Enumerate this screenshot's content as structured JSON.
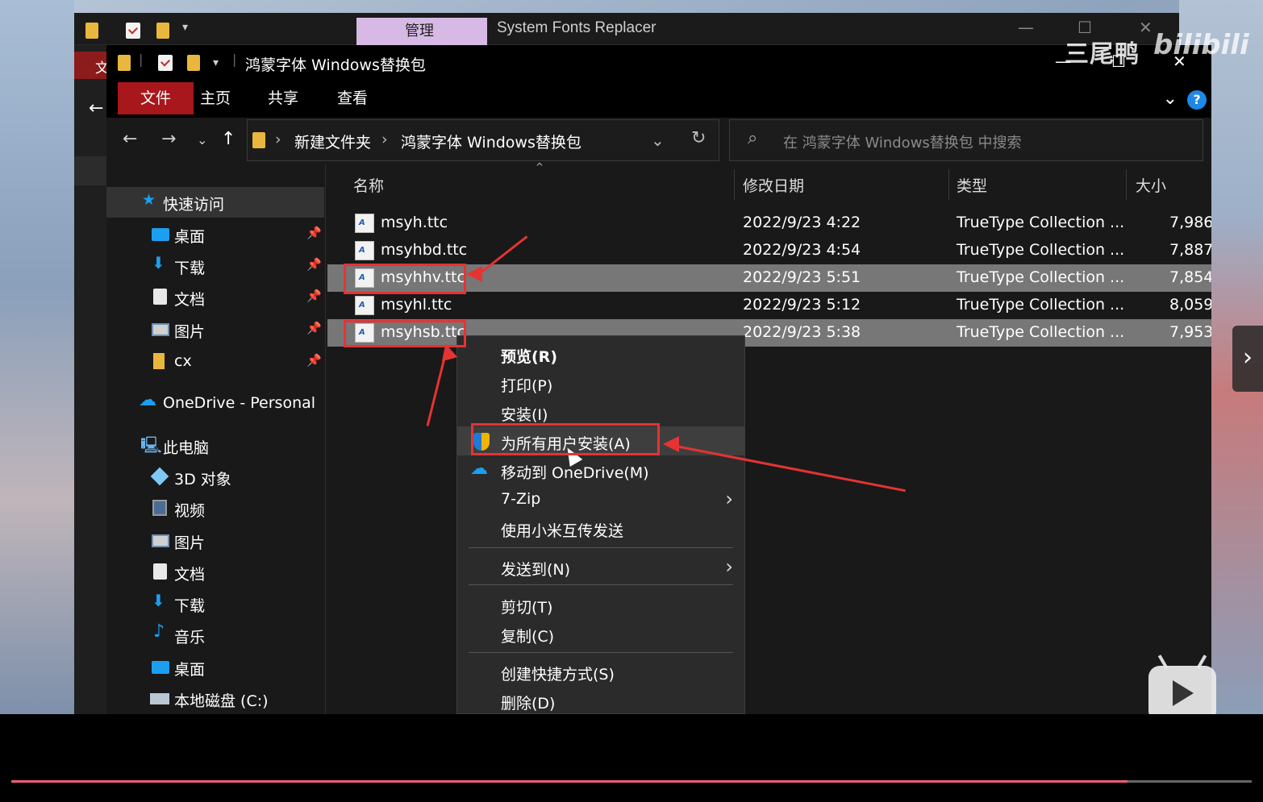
{
  "back_window": {
    "manage_tab": "管理",
    "title": "System Fonts Replacer",
    "file_tab_partial": "文"
  },
  "window": {
    "title": "鸿蒙字体 Windows替换包",
    "ribbon_tabs": [
      "文件",
      "主页",
      "共享",
      "查看"
    ],
    "help": "?"
  },
  "address": {
    "crumbs": [
      "新建文件夹",
      "鸿蒙字体 Windows替换包"
    ]
  },
  "search": {
    "placeholder": "在 鸿蒙字体 Windows替换包 中搜索"
  },
  "nav_pane": {
    "quick_access": "快速访问",
    "quick_items": [
      "桌面",
      "下载",
      "文档",
      "图片",
      "cx"
    ],
    "onedrive": "OneDrive - Personal",
    "this_pc": "此电脑",
    "pc_items": [
      "3D 对象",
      "视频",
      "图片",
      "文档",
      "下载",
      "音乐",
      "桌面",
      "本地磁盘 (C:)"
    ]
  },
  "columns": {
    "name": "名称",
    "date": "修改日期",
    "type": "类型",
    "size": "大小"
  },
  "files": [
    {
      "name": "msyh.ttc",
      "date": "2022/9/23 4:22",
      "type": "TrueType Collection ...",
      "size": "7,986",
      "selected": false
    },
    {
      "name": "msyhbd.ttc",
      "date": "2022/9/23 4:54",
      "type": "TrueType Collection ...",
      "size": "7,887",
      "selected": false
    },
    {
      "name": "msyhhv.ttc",
      "date": "2022/9/23 5:51",
      "type": "TrueType Collection ...",
      "size": "7,854",
      "selected": true
    },
    {
      "name": "msyhl.ttc",
      "date": "2022/9/23 5:12",
      "type": "TrueType Collection ...",
      "size": "8,059",
      "selected": false
    },
    {
      "name": "msyhsb.ttc",
      "date": "2022/9/23 5:38",
      "type": "TrueType Collection ...",
      "size": "7,953",
      "selected": true
    }
  ],
  "context_menu": {
    "preview": "预览(R)",
    "print": "打印(P)",
    "install": "安装(I)",
    "install_all_users": "为所有用户安装(A)",
    "move_onedrive": "移动到 OneDrive(M)",
    "seven_zip": "7-Zip",
    "xiaomi_send": "使用小米互传发送",
    "send_to": "发送到(N)",
    "cut": "剪切(T)",
    "copy": "复制(C)",
    "create_shortcut": "创建快捷方式(S)",
    "delete": "删除(D)"
  },
  "watermark": {
    "author": "三尾鸭",
    "site": "bilibili"
  },
  "player": {
    "progress": 0.9
  },
  "colors": {
    "accent_red": "#a8171b",
    "annotation_red": "#e53333",
    "selection_gray": "#777777",
    "progress_pink": "#f35b7d"
  }
}
